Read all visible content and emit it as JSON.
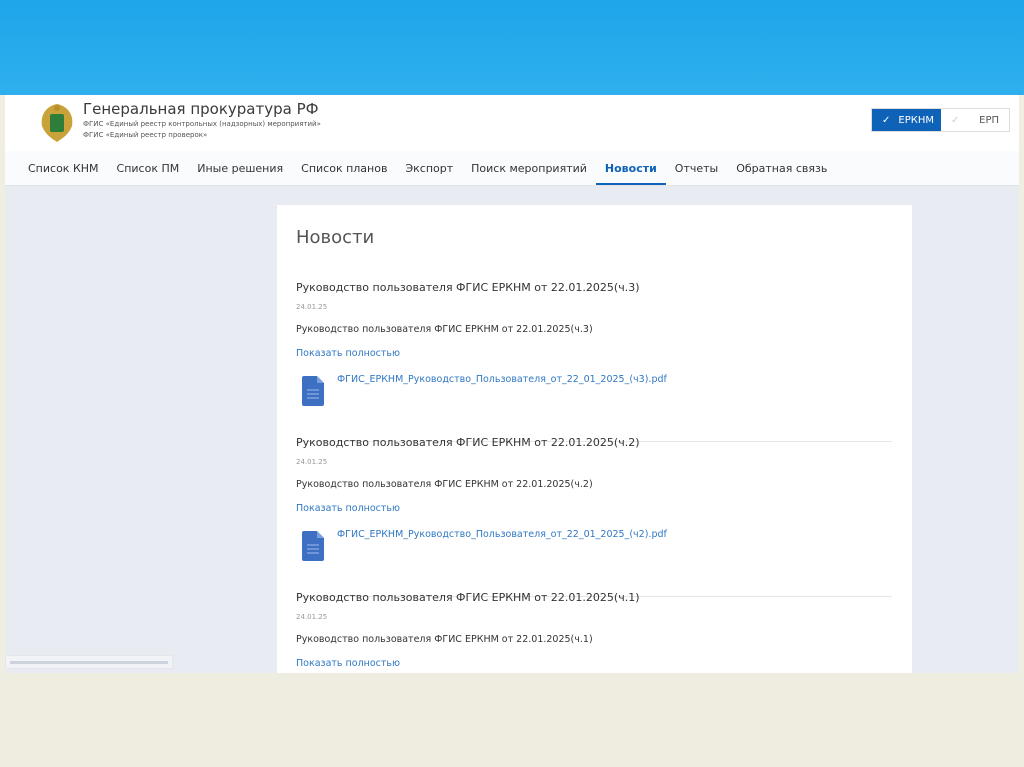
{
  "header": {
    "title": "Генеральная прокуратура РФ",
    "subtitle1": "ФГИС «Единый реестр контрольных (надзорных) мероприятий»",
    "subtitle2": "ФГИС «Единый реестр проверок»"
  },
  "switch": {
    "on": "ЕРКНМ",
    "off": "ЕРП",
    "check": "✓"
  },
  "nav": [
    "Список КНМ",
    "Список ПМ",
    "Иные решения",
    "Список планов",
    "Экспорт",
    "Поиск мероприятий",
    "Новости",
    "Отчеты",
    "Обратная связь"
  ],
  "nav_active": "Новости",
  "news": {
    "heading": "Новости",
    "items": [
      {
        "title": "Руководство пользователя ФГИС ЕРКНМ от 22.01.2025(ч.3)",
        "date": "24.01.25",
        "desc": "Руководство пользователя ФГИС ЕРКНМ от 22.01.2025(ч.3)",
        "more": "Показать полностью",
        "file": "ФГИС_ЕРКНМ_Руководство_Пользователя_от_22_01_2025_(ч3).pdf"
      },
      {
        "title": "Руководство пользователя ФГИС ЕРКНМ от 22.01.2025(ч.2)",
        "date": "24.01.25",
        "desc": "Руководство пользователя ФГИС ЕРКНМ от 22.01.2025(ч.2)",
        "more": "Показать полностью",
        "file": "ФГИС_ЕРКНМ_Руководство_Пользователя_от_22_01_2025_(ч2).pdf"
      },
      {
        "title": "Руководство пользователя ФГИС ЕРКНМ от 22.01.2025(ч.1)",
        "date": "24.01.25",
        "desc": "Руководство пользователя ФГИС ЕРКНМ от 22.01.2025(ч.1)",
        "more": "Показать полностью"
      }
    ]
  },
  "colors": {
    "accent": "#0e63b9",
    "link": "#2f78c4",
    "slide_top": "#1ea5ea",
    "slide_bottom": "#efeddf"
  }
}
